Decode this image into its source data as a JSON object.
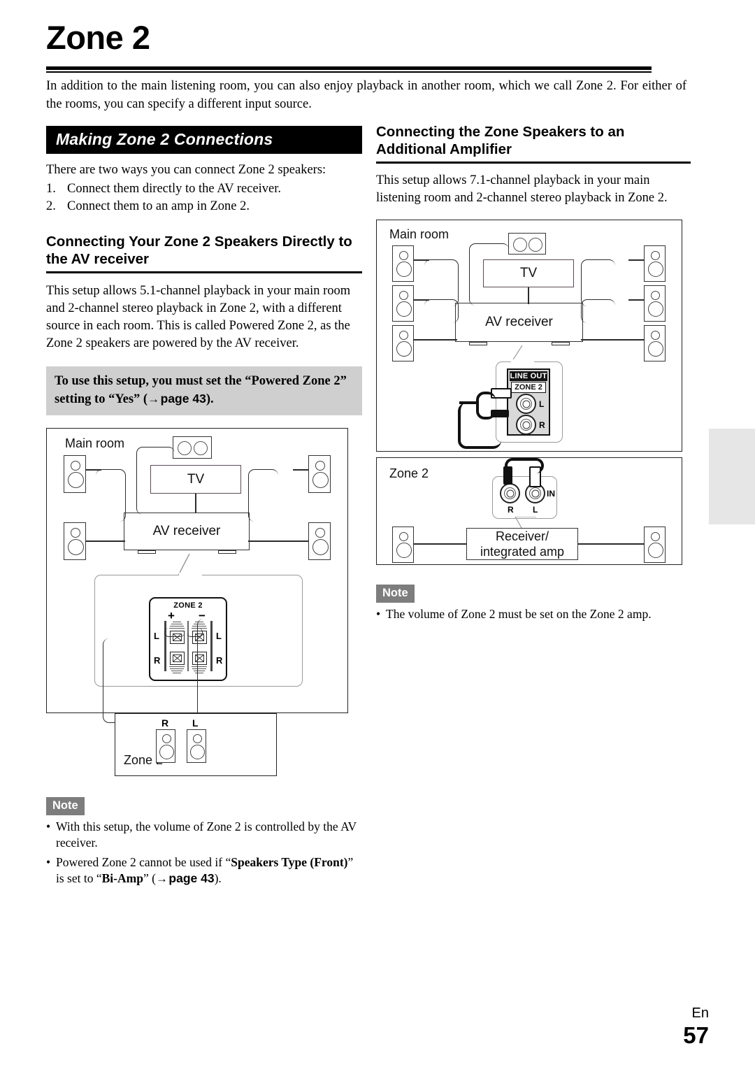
{
  "page": {
    "title": "Zone 2",
    "intro": "In addition to the main listening room, you can also enjoy playback in another room, which we call Zone 2. For either of the rooms, you can specify a different input source.",
    "footer_lang": "En",
    "footer_page": "57"
  },
  "left": {
    "banner": "Making Zone 2 Connections",
    "lead": "There are two ways you can connect Zone 2 speakers:",
    "list": [
      {
        "num": "1.",
        "text": "Connect them directly to the AV receiver."
      },
      {
        "num": "2.",
        "text": "Connect them to an amp in Zone 2."
      }
    ],
    "subhead": "Connecting Your Zone 2 Speakers Directly to the AV receiver",
    "body": "This setup allows 5.1-channel playback in your main room and 2-channel stereo playback in Zone 2, with a different source in each room. This is called Powered Zone 2, as the Zone 2 speakers are powered by the AV receiver.",
    "callout_pre": "To use this setup, you must set the “Powered Zone 2” setting to “Yes” (",
    "callout_arrow": "→",
    "callout_page": "page 43",
    "callout_post": ").",
    "diagram": {
      "room_label": "Main room",
      "tv_label": "TV",
      "receiver_label": "AV receiver",
      "terminal_title": "ZONE 2",
      "plus": "+",
      "minus": "−",
      "term_l_left": "L",
      "term_l_right": "L",
      "term_r_left": "R",
      "term_r_right": "R",
      "zone2_label": "Zone 2",
      "zone2_spk_r": "R",
      "zone2_spk_l": "L"
    },
    "note_badge": "Note",
    "notes": [
      {
        "text": "With this setup, the volume of Zone 2 is controlled by the AV receiver."
      },
      {
        "text": "Powered Zone 2 cannot be used if “Speakers Type (Front)” is set to “Bi-Amp” (→ page 43)."
      }
    ],
    "note2_pre": "Powered Zone 2 cannot be used if “",
    "note2_bold1": "Speakers Type (Front)",
    "note2_mid": "” is set to “",
    "note2_bold2": "Bi-Amp",
    "note2_arrow": "→",
    "note2_page": "page 43",
    "note2_post": ")."
  },
  "right": {
    "subhead": "Connecting the Zone Speakers to an Additional Amplifier",
    "body": "This setup allows 7.1-channel playback in your main listening room and 2-channel stereo playback in Zone 2.",
    "diagram": {
      "room_label": "Main room",
      "tv_label": "TV",
      "receiver_label": "AV receiver",
      "lineout_label": "LINE OUT",
      "lineout_zone": "ZONE 2",
      "lineout_l": "L",
      "lineout_r": "R",
      "zone2_label": "Zone 2",
      "in_label": "IN",
      "in_r": "R",
      "in_l": "L",
      "amp_line1": "Receiver/",
      "amp_line2": "integrated amp"
    },
    "note_badge": "Note",
    "notes": [
      {
        "text": "The volume of Zone 2 must be set on the Zone 2 amp."
      }
    ]
  }
}
